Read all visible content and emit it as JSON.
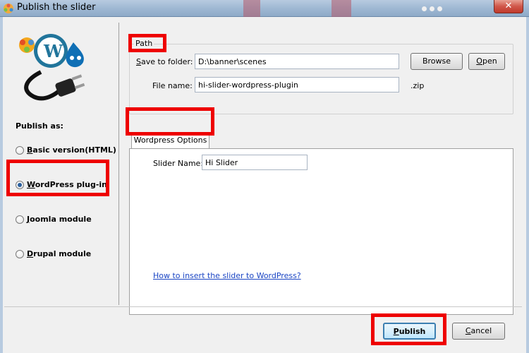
{
  "window": {
    "title": "Publish the slider",
    "close_symbol": "✕"
  },
  "left_panel": {
    "publish_as_label": "Publish as:",
    "options": [
      {
        "label": "Basic version(HTML)",
        "hotkey": "B",
        "rest": "asic version(HTML)",
        "checked": false
      },
      {
        "label": "WordPress plug-in",
        "hotkey": "W",
        "rest": "ordPress plug-in",
        "checked": true
      },
      {
        "label": "Joomla module",
        "hotkey": "J",
        "rest": "oomla module",
        "checked": false
      },
      {
        "label": "Drupal module",
        "hotkey": "D",
        "rest": "rupal module",
        "checked": false
      }
    ]
  },
  "path": {
    "legend": "Path",
    "save_to_folder_label_hotkey": "S",
    "save_to_folder_label_rest": "ave to folder:",
    "save_to_folder_value": "D:\\banner\\scenes",
    "browse_label": "Browse",
    "open_label_hotkey": "O",
    "open_label_rest": "pen",
    "file_name_label": "File name:",
    "file_name_value": "hi-slider-wordpress-plugin",
    "extension": ".zip"
  },
  "options_tab": {
    "tab_label": "Wordpress Options",
    "slider_name_label": "Slider Name:",
    "slider_name_value": "Hi Slider",
    "help_link": "How to insert the slider to WordPress?"
  },
  "footer": {
    "publish_hotkey": "P",
    "publish_rest": "ublish",
    "cancel_hotkey": "C",
    "cancel_rest": "ancel"
  },
  "colors": {
    "highlight": "#ee0000",
    "link": "#1a45c4",
    "accent": "#2a5f9e"
  }
}
